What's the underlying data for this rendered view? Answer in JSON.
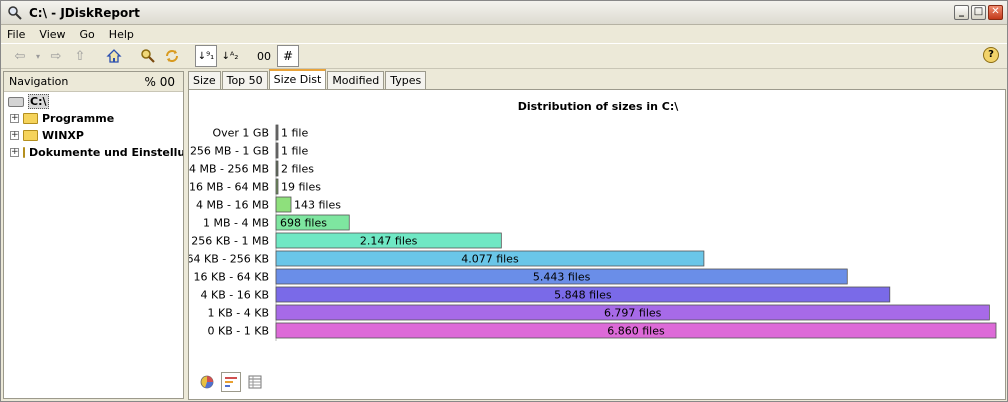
{
  "window": {
    "title": "C:\\ - JDiskReport"
  },
  "menu": {
    "items": [
      "File",
      "View",
      "Go",
      "Help"
    ]
  },
  "toolbar": {
    "back": "⇦",
    "forward": "⇨",
    "up": "⇧",
    "home": "⌂",
    "sort_size": "↓⁹₁",
    "sort_name": "↓ᴬ₂",
    "format_00": "00",
    "format_hash": "#",
    "help": "?"
  },
  "navigation": {
    "header": "Navigation",
    "header_extra": "%  00",
    "tree": [
      {
        "label": "C:\\",
        "type": "drive"
      },
      {
        "label": "Programme",
        "type": "folder"
      },
      {
        "label": "WINXP",
        "type": "folder"
      },
      {
        "label": "Dokumente und Einstellungen",
        "type": "folder"
      }
    ]
  },
  "tabs": [
    "Size",
    "Top 50",
    "Size Dist",
    "Modified",
    "Types"
  ],
  "selected_tab": "Size Dist",
  "chart_data": {
    "type": "bar",
    "orientation": "horizontal",
    "title": "Distribution of sizes in C:\\",
    "categories": [
      "Over 1 GB",
      "256 MB - 1 GB",
      "64 MB - 256 MB",
      "16 MB - 64 MB",
      "4 MB - 16 MB",
      "1 MB - 4 MB",
      "256 KB - 1 MB",
      "64 KB - 256 KB",
      "16 KB - 64 KB",
      "4 KB - 16 KB",
      "1 KB - 4 KB",
      "0 KB - 1 KB"
    ],
    "values": [
      1,
      1,
      2,
      19,
      143,
      698,
      2147,
      4077,
      5443,
      5848,
      6797,
      6860
    ],
    "labels": [
      "1 file",
      "1 file",
      "2 files",
      "19 files",
      "143 files",
      "698 files",
      "2.147 files",
      "4.077 files",
      "5.443 files",
      "5.848 files",
      "6.797 files",
      "6.860 files"
    ],
    "colors": [
      "#6b6b6b",
      "#6b6b6b",
      "#5f6b5a",
      "#6d8f5a",
      "#8ee07c",
      "#7ee6a0",
      "#6fe8c4",
      "#6ac6e8",
      "#6a8ee8",
      "#7a6ae8",
      "#a76ae8",
      "#dd6ad8"
    ]
  },
  "view_buttons": [
    "pie-chart-icon",
    "bar-chart-icon",
    "table-icon"
  ]
}
